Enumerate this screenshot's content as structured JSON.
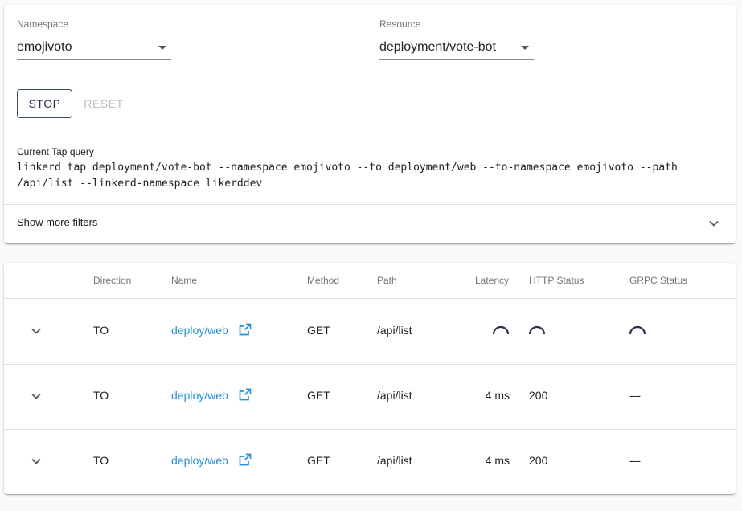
{
  "controls": {
    "namespace": {
      "label": "Namespace",
      "value": "emojivoto"
    },
    "resource": {
      "label": "Resource",
      "value": "deployment/vote-bot"
    },
    "stop_label": "STOP",
    "reset_label": "RESET"
  },
  "query": {
    "label": "Current Tap query",
    "line1": "linkerd tap deployment/vote-bot --namespace emojivoto --to deployment/web --to-namespace emojivoto --path",
    "line2": "/api/list --linkerd-namespace likerddev"
  },
  "filters": {
    "label": "Show more filters",
    "icon": "chevron-down-icon"
  },
  "table": {
    "headers": {
      "direction": "Direction",
      "name": "Name",
      "method": "Method",
      "path": "Path",
      "latency": "Latency",
      "http_status": "HTTP Status",
      "grpc_status": "GRPC Status"
    },
    "rows": [
      {
        "direction": "TO",
        "name": "deploy/web",
        "method": "GET",
        "path": "/api/list",
        "latency": "",
        "http_status": "",
        "grpc_status": "",
        "pending": true
      },
      {
        "direction": "TO",
        "name": "deploy/web",
        "method": "GET",
        "path": "/api/list",
        "latency": "4 ms",
        "http_status": "200",
        "grpc_status": "---",
        "pending": false
      },
      {
        "direction": "TO",
        "name": "deploy/web",
        "method": "GET",
        "path": "/api/list",
        "latency": "4 ms",
        "http_status": "200",
        "grpc_status": "---",
        "pending": false
      }
    ]
  },
  "colors": {
    "link": "#2b8fd6",
    "spinner": "#283149",
    "button_border": "#3d4b6b"
  }
}
